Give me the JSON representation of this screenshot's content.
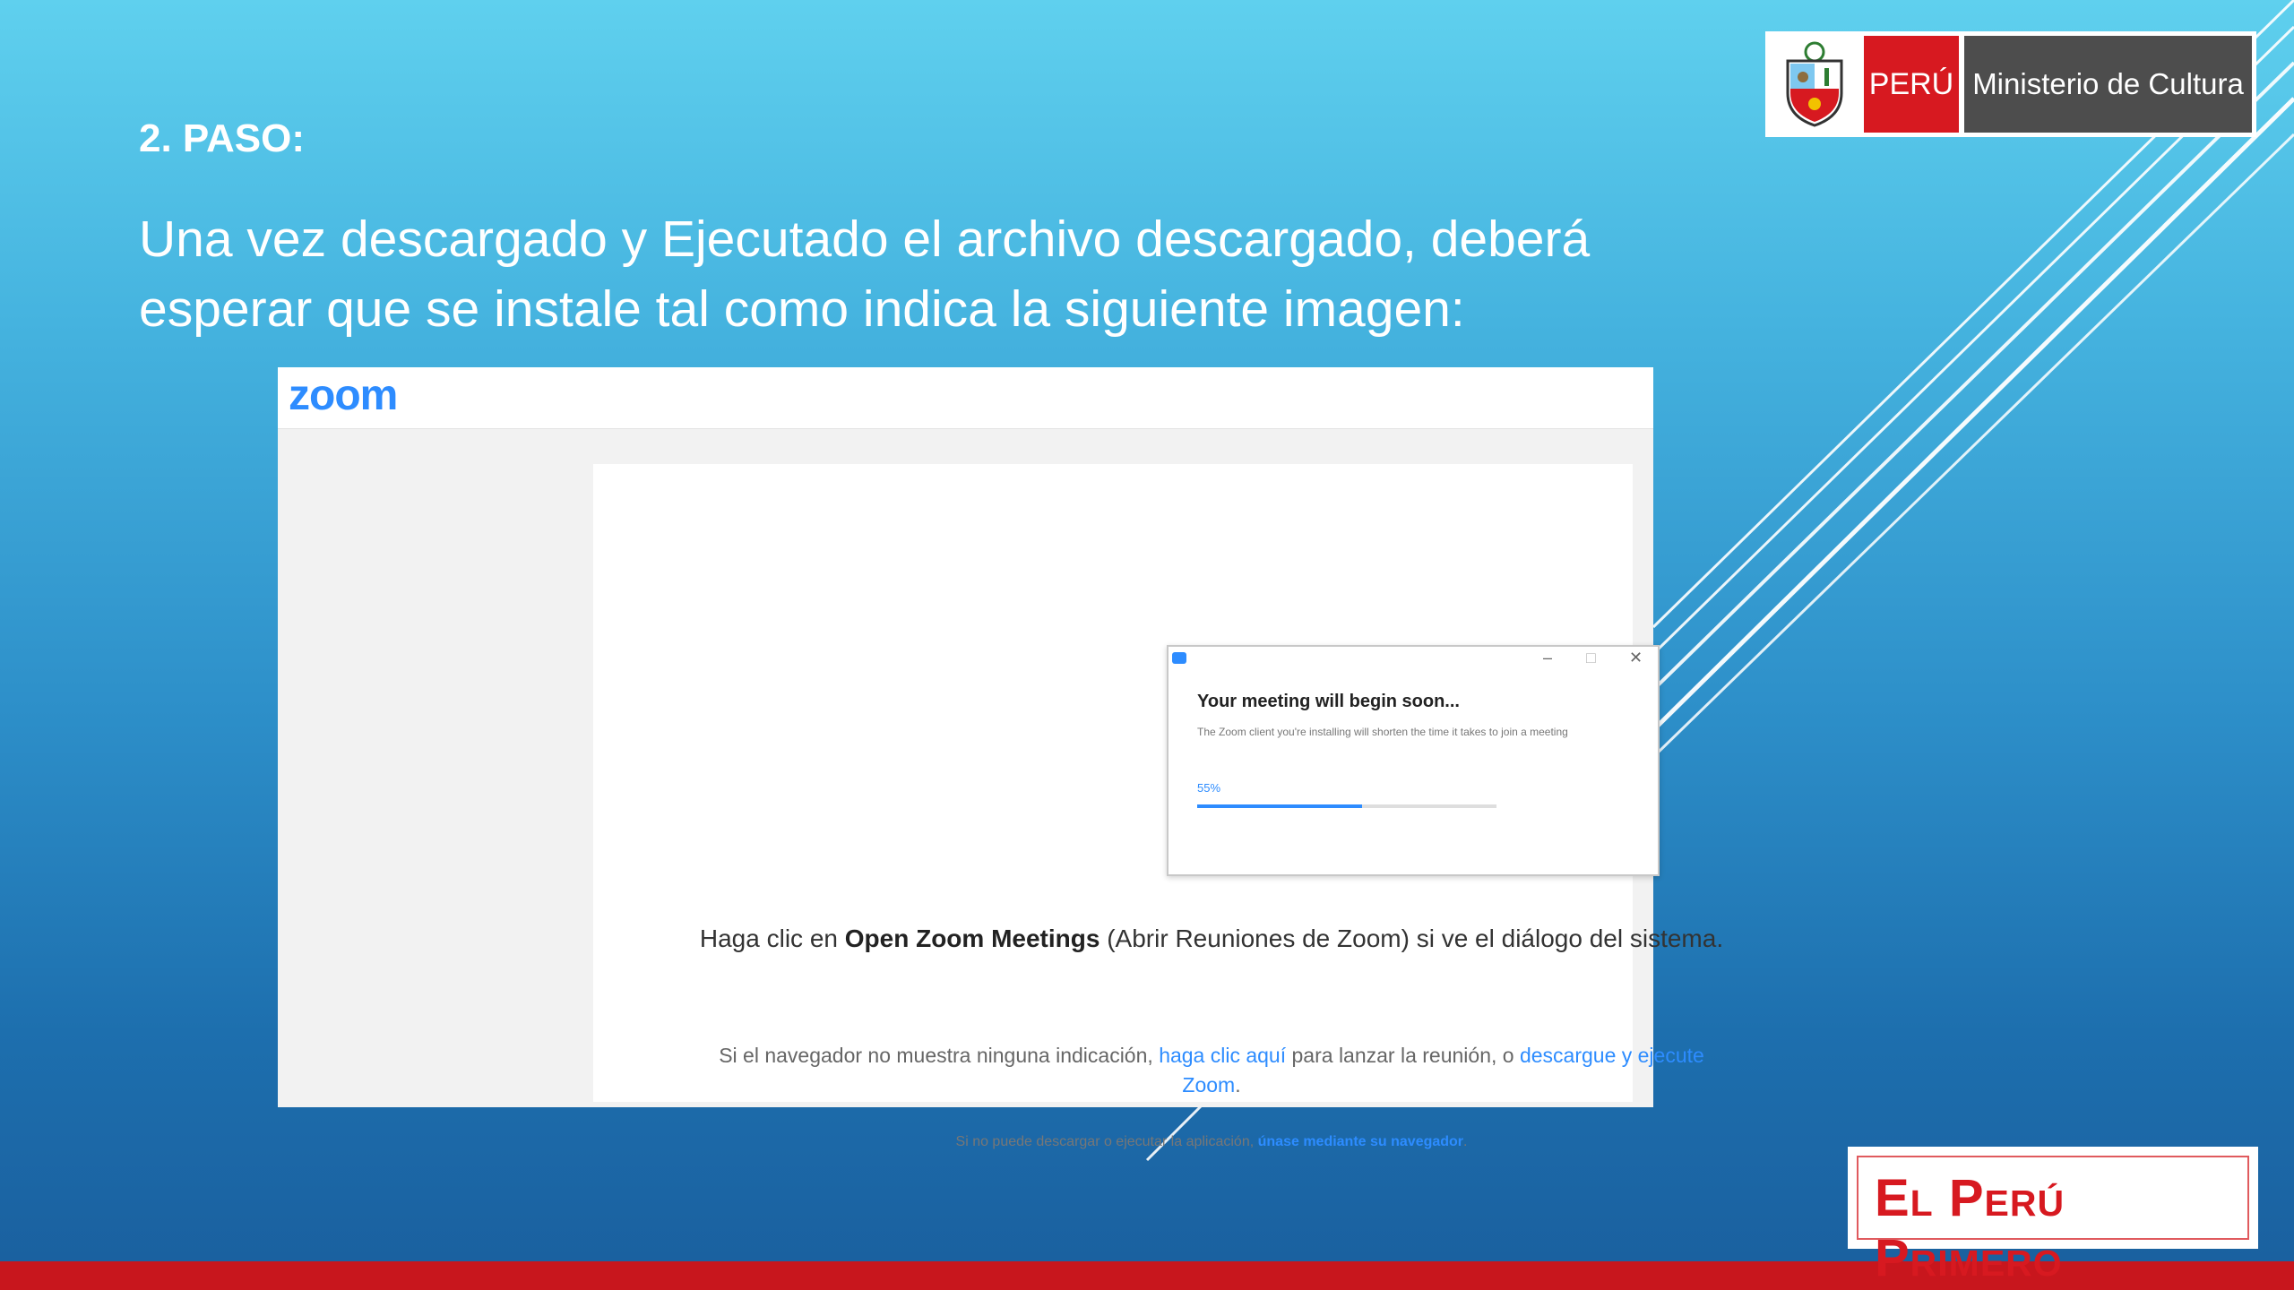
{
  "slide": {
    "step_title": "2. PASO:",
    "step_text": "Una vez descargado y Ejecutado el archivo descargado, deberá esperar que se instale tal como indica la siguiente imagen:"
  },
  "gov_logo": {
    "icon": "peru-coat-of-arms-icon",
    "country": "PERÚ",
    "ministry": "Ministerio de Cultura",
    "colors": {
      "red": "#d71920",
      "gray": "#4d4d4d"
    }
  },
  "brand_logo": {
    "text": "El Perú Primero",
    "color": "#d71920"
  },
  "zoom_page": {
    "logo": "zoom",
    "brand_color": "#2d8cff",
    "dialog": {
      "app_icon": "zoom-app-icon",
      "minimize": "–",
      "maximize": "□",
      "close": "✕",
      "title": "Your meeting will begin soon...",
      "subtitle": "The Zoom client you're installing will shorten the time it takes to join a meeting",
      "progress_label": "55%",
      "progress": 0.55
    },
    "instruction": {
      "pre": "Haga clic en ",
      "bold": "Open Zoom Meetings",
      "post": " (Abrir Reuniones de Zoom) si ve el diálogo del sistema."
    },
    "note": {
      "pre": "Si el navegador no muestra ninguna indicación, ",
      "link1": "haga clic aquí",
      "mid": " para lanzar la reunión, o ",
      "link2": "descargue y ejecute Zoom",
      "post": "."
    },
    "small_note": {
      "pre": "Si no puede descargar o ejecutar la aplicación, ",
      "link": "únase mediante su navegador",
      "post": "."
    }
  }
}
